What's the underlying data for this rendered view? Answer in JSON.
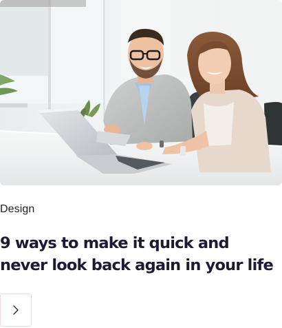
{
  "article": {
    "category": "Design",
    "title": "9 ways to make it quick and never look back again in your life"
  },
  "image": {
    "subject": "two colleagues smiling at a laptop in a bright office"
  },
  "icons": {
    "next": "chevron-right-icon"
  },
  "colors": {
    "title": "#1c1a35",
    "button_border": "#f2d8dc",
    "button_icon": "#1c1a35"
  }
}
